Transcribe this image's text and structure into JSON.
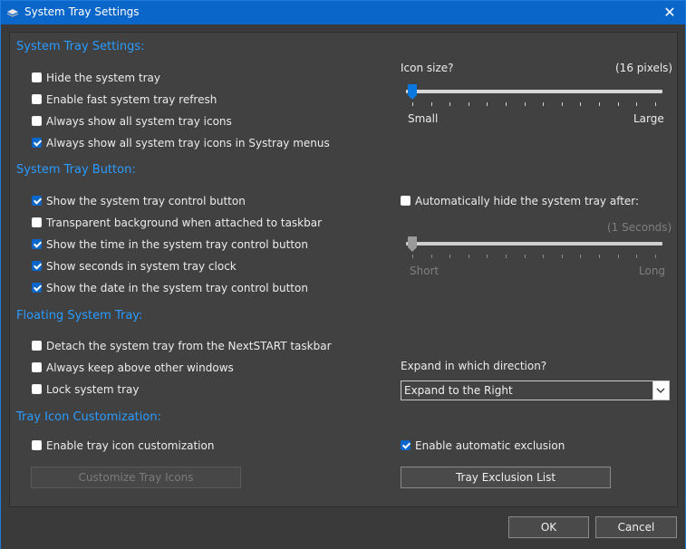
{
  "window": {
    "title": "System Tray Settings",
    "close_glyph": "✕",
    "icon": "settings-app-icon",
    "accent_color": "#0a67c9",
    "section_color": "#2a9bff"
  },
  "sections": {
    "tray": "System Tray Settings:",
    "button": "System Tray Button:",
    "floating": "Floating System Tray:",
    "customization": "Tray Icon Customization:"
  },
  "tray": {
    "hide": {
      "label": "Hide the system tray",
      "checked": false
    },
    "fast_refresh": {
      "label": "Enable fast system tray refresh",
      "checked": false
    },
    "show_all": {
      "label": "Always show all system tray icons",
      "checked": false
    },
    "show_all_menus": {
      "label": "Always show all system tray icons in Systray menus",
      "checked": true
    },
    "icon_size": {
      "label": "Icon size?",
      "value_text": "(16 pixels)",
      "min_label": "Small",
      "max_label": "Large",
      "level": 0
    }
  },
  "button": {
    "show_control": {
      "label": "Show the system tray control button",
      "checked": true
    },
    "transparent": {
      "label": "Transparent background when attached to taskbar",
      "checked": false
    },
    "show_time": {
      "label": "Show the time in the system tray control button",
      "checked": true
    },
    "show_seconds": {
      "label": "Show seconds in system tray clock",
      "checked": true
    },
    "show_date": {
      "label": "Show the date in the system tray control button",
      "checked": true
    },
    "auto_hide": {
      "label": "Automatically hide the system tray after:",
      "checked": false
    },
    "hide_delay": {
      "value_text": "(1 Seconds)",
      "min_label": "Short",
      "max_label": "Long",
      "level": 0
    }
  },
  "floating": {
    "detach": {
      "label": "Detach the system tray from the NextSTART taskbar",
      "checked": false
    },
    "keep_above": {
      "label": "Always keep above other windows",
      "checked": false
    },
    "lock": {
      "label": "Lock system tray",
      "checked": false
    },
    "direction_label": "Expand in which direction?",
    "direction_value": "Expand to the Right"
  },
  "customization": {
    "enable": {
      "label": "Enable tray icon customization",
      "checked": false
    },
    "customize_button": "Customize Tray Icons",
    "auto_exclusion": {
      "label": "Enable automatic exclusion",
      "checked": true
    },
    "exclusion_button": "Tray Exclusion List"
  },
  "footer": {
    "ok": "OK",
    "cancel": "Cancel"
  }
}
